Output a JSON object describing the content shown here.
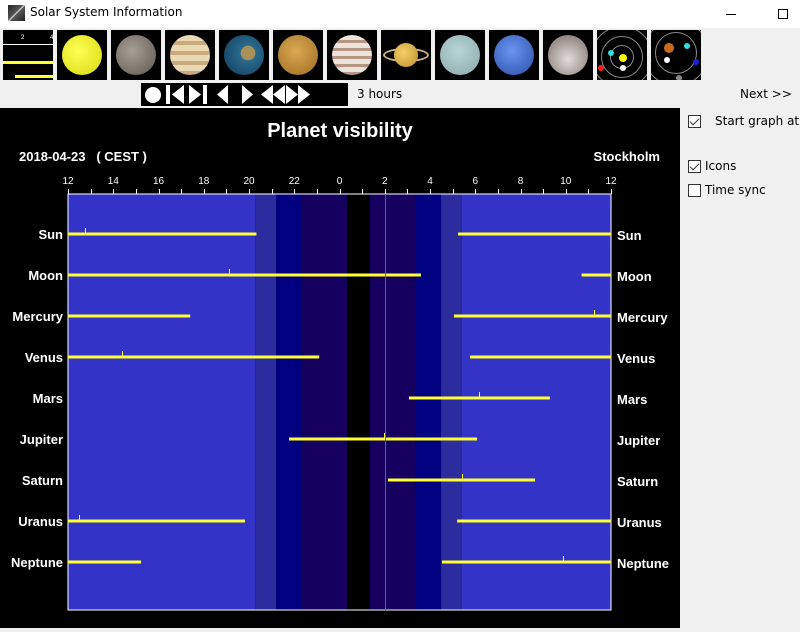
{
  "window": {
    "title": "Solar System Information",
    "minimize_label": "minimize",
    "maximize_label": "maximize"
  },
  "thumbnails": [
    {
      "name": "visibility-graph",
      "kind": "graph",
      "tick_labels": [
        "2",
        "4"
      ]
    },
    {
      "name": "sun",
      "kind": "planet",
      "color": "#e8e81c"
    },
    {
      "name": "mercury",
      "kind": "planet",
      "color": "#8a8278"
    },
    {
      "name": "venus",
      "kind": "planet",
      "color": "#d9c39a"
    },
    {
      "name": "earth",
      "kind": "planet",
      "color": "#2a6a8c"
    },
    {
      "name": "mars",
      "kind": "planet",
      "color": "#c4903c"
    },
    {
      "name": "jupiter",
      "kind": "planet",
      "color": "#c9b9a4"
    },
    {
      "name": "saturn",
      "kind": "planet",
      "color": "#e2b04a"
    },
    {
      "name": "uranus",
      "kind": "planet",
      "color": "#a7c4c6"
    },
    {
      "name": "neptune",
      "kind": "planet",
      "color": "#4a76d8"
    },
    {
      "name": "pluto",
      "kind": "planet",
      "color": "#c8c2bd"
    },
    {
      "name": "inner-orbits",
      "kind": "orbits",
      "label": "Earth"
    },
    {
      "name": "outer-orbits",
      "kind": "orbits",
      "label": "Jupiter"
    }
  ],
  "controls": {
    "buttons": [
      "now",
      "first",
      "last",
      "step-back",
      "step-forward",
      "fast-back",
      "fast-forward"
    ],
    "step_label": "3 hours",
    "next_label": "Next  >>"
  },
  "sidebar": {
    "options": [
      {
        "label": "Start graph at local noon",
        "checked": true
      },
      {
        "label": "Icons",
        "checked": true
      },
      {
        "label": "Time sync",
        "checked": false
      }
    ]
  },
  "chart_data": {
    "type": "gantt",
    "title": "Planet visibility",
    "date_label": "2018-04-23   ( CEST )",
    "location": "Stockholm",
    "x_unit": "hours since 12:00 local (2018-04-23)",
    "xlim": [
      0,
      24
    ],
    "x_tick_labels": [
      "12",
      "14",
      "16",
      "18",
      "20",
      "22",
      "0",
      "2",
      "4",
      "6",
      "8",
      "10",
      "12"
    ],
    "current_time_hours": 14.0,
    "current_time_color": "#ff2020",
    "sky_bands": [
      {
        "from": 0,
        "to": 8.27,
        "sky": "day",
        "color": "#3333c8"
      },
      {
        "from": 8.27,
        "to": 9.2,
        "sky": "civil-twilight",
        "color": "#2c2c9e"
      },
      {
        "from": 9.2,
        "to": 10.35,
        "sky": "nautical-twilight",
        "color": "#000080"
      },
      {
        "from": 10.35,
        "to": 12.33,
        "sky": "astronomical-twilight",
        "color": "#150060"
      },
      {
        "from": 12.33,
        "to": 13.35,
        "sky": "night",
        "color": "#000000"
      },
      {
        "from": 13.35,
        "to": 15.34,
        "sky": "astronomical-twilight",
        "color": "#150060"
      },
      {
        "from": 15.34,
        "to": 16.49,
        "sky": "nautical-twilight",
        "color": "#000080"
      },
      {
        "from": 16.49,
        "to": 17.41,
        "sky": "civil-twilight",
        "color": "#2c2c9e"
      },
      {
        "from": 17.41,
        "to": 24,
        "sky": "day",
        "color": "#3333c8"
      }
    ],
    "bar_color": "#ffff33",
    "series": [
      {
        "name": "Sun",
        "intervals": [
          [
            0,
            8.33
          ],
          [
            17.24,
            24
          ]
        ],
        "transit": 0.75
      },
      {
        "name": "Moon",
        "intervals": [
          [
            0,
            15.6
          ],
          [
            22.7,
            24
          ]
        ],
        "transit": 7.1
      },
      {
        "name": "Mercury",
        "intervals": [
          [
            0,
            5.4
          ],
          [
            17.06,
            24
          ]
        ],
        "transit": 23.25
      },
      {
        "name": "Venus",
        "intervals": [
          [
            0,
            11.1
          ],
          [
            17.77,
            24
          ]
        ],
        "transit": 2.4
      },
      {
        "name": "Mars",
        "intervals": [
          [
            15.07,
            21.3
          ]
        ],
        "transit": 18.17
      },
      {
        "name": "Jupiter",
        "intervals": [
          [
            9.77,
            18.08
          ]
        ],
        "transit": 13.97
      },
      {
        "name": "Saturn",
        "intervals": [
          [
            14.14,
            20.64
          ]
        ],
        "transit": 17.41
      },
      {
        "name": "Uranus",
        "intervals": [
          [
            0,
            7.82
          ],
          [
            17.2,
            24
          ]
        ],
        "transit": 0.5
      },
      {
        "name": "Neptune",
        "intervals": [
          [
            0,
            3.23
          ],
          [
            16.53,
            24
          ]
        ],
        "transit": 21.88
      }
    ]
  }
}
